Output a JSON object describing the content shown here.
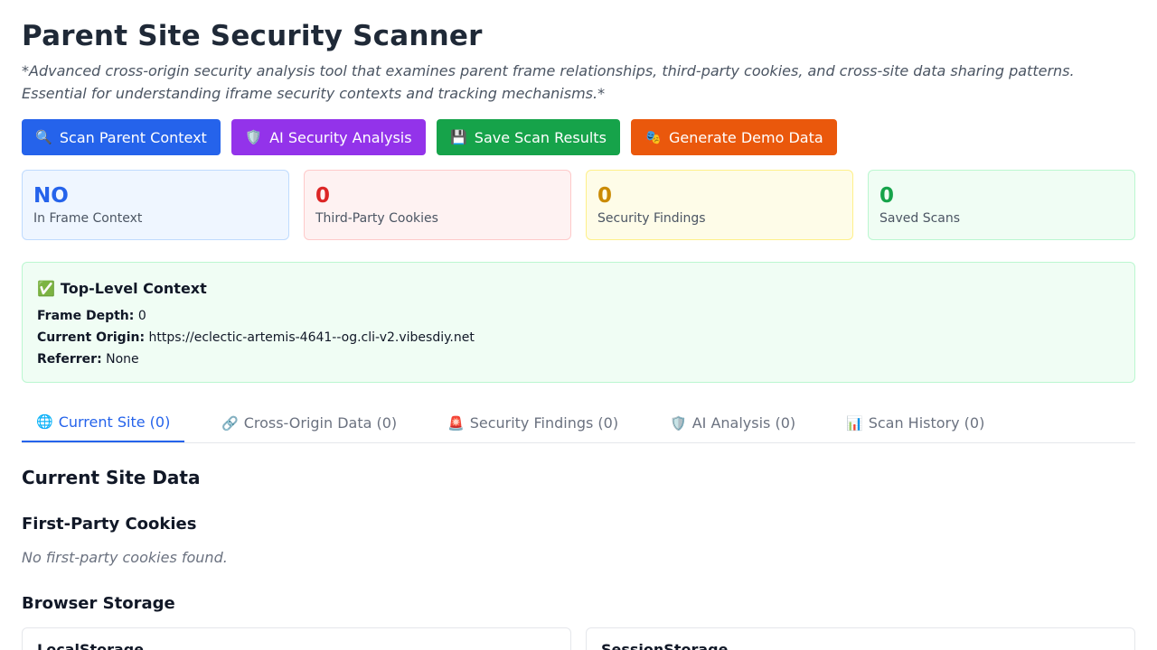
{
  "header": {
    "title": "Parent Site Security Scanner",
    "subtitle": "*Advanced cross-origin security analysis tool that examines parent frame relationships, third-party cookies, and cross-site data sharing patterns. Essential for understanding iframe security contexts and tracking mechanisms.*"
  },
  "actions": {
    "scan": {
      "icon": "🔍",
      "icon_name": "magnifier-icon",
      "label": "Scan Parent Context",
      "color": "#2563eb"
    },
    "ai": {
      "icon": "🛡️",
      "icon_name": "shield-icon",
      "label": "AI Security Analysis",
      "color": "#9333ea"
    },
    "save": {
      "icon": "💾",
      "icon_name": "floppy-disk-icon",
      "label": "Save Scan Results",
      "color": "#16a34a"
    },
    "demo": {
      "icon": "🎭",
      "icon_name": "theater-masks-icon",
      "label": "Generate Demo Data",
      "color": "#ea580c"
    }
  },
  "stats": [
    {
      "value": "NO",
      "label": "In Frame Context",
      "color": "#2563eb"
    },
    {
      "value": "0",
      "label": "Third-Party Cookies",
      "color": "#dc2626"
    },
    {
      "value": "0",
      "label": "Security Findings",
      "color": "#ca8a04"
    },
    {
      "value": "0",
      "label": "Saved Scans",
      "color": "#16a34a"
    }
  ],
  "context": {
    "icon": "✅",
    "icon_name": "check-mark-icon",
    "title": "Top-Level Context",
    "frame_depth_label": "Frame Depth:",
    "frame_depth": "0",
    "origin_label": "Current Origin:",
    "origin": "https://eclectic-artemis-4641--og.cli-v2.vibesdiy.net",
    "referrer_label": "Referrer:",
    "referrer": "None"
  },
  "tabs": [
    {
      "icon": "🌐",
      "icon_name": "globe-icon",
      "label": "Current Site (0)",
      "active": true
    },
    {
      "icon": "🔗",
      "icon_name": "link-icon",
      "label": "Cross-Origin Data (0)",
      "active": false
    },
    {
      "icon": "🚨",
      "icon_name": "siren-icon",
      "label": "Security Findings (0)",
      "active": false
    },
    {
      "icon": "🛡️",
      "icon_name": "shield-icon",
      "label": "AI Analysis (0)",
      "active": false
    },
    {
      "icon": "📊",
      "icon_name": "bar-chart-icon",
      "label": "Scan History (0)",
      "active": false
    }
  ],
  "main": {
    "section_title": "Current Site Data",
    "cookies_title": "First-Party Cookies",
    "cookies_empty": "No first-party cookies found.",
    "storage_title": "Browser Storage",
    "storage_cards": [
      {
        "title": "LocalStorage"
      },
      {
        "title": "SessionStorage"
      }
    ]
  }
}
